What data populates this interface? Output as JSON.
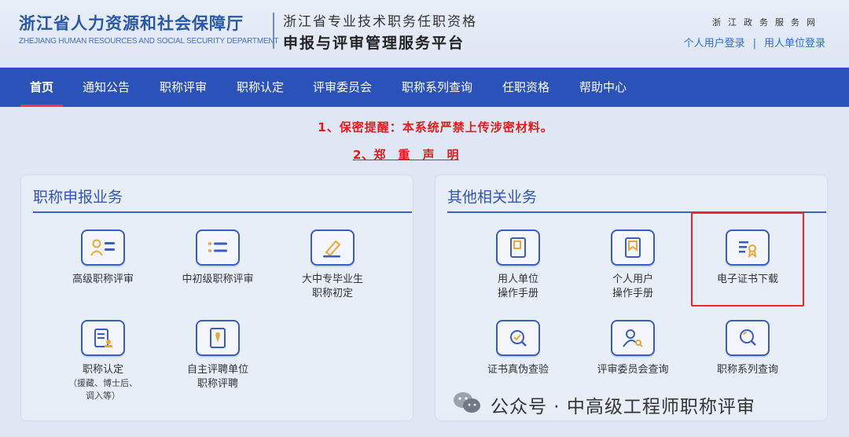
{
  "header": {
    "org_cn": "浙江省人力资源和社会保障厅",
    "org_en": "ZHEJIANG HUMAN RESOURCES AND SOCIAL SECURITY DEPARTMENT",
    "platform_line1": "浙江省专业技术职务任职资格",
    "platform_line2": "申报与评审管理服务平台",
    "gov_net": "浙江政务服务网",
    "login_personal": "个人用户登录",
    "login_sep": "|",
    "login_unit": "用人单位登录"
  },
  "nav": {
    "items": [
      "首页",
      "通知公告",
      "职称评审",
      "职称认定",
      "评审委员会",
      "职称系列查询",
      "任职资格",
      "帮助中心"
    ]
  },
  "notices": {
    "line1": "1、保密提醒：本系统严禁上传涉密材料。",
    "line2": "2、郑　重　声　明"
  },
  "left_panel": {
    "title": "职称申报业务",
    "tiles": [
      {
        "label": "高级职称评审",
        "icon": "person-card-icon"
      },
      {
        "label": "中初级职称评审",
        "icon": "list-icon"
      },
      {
        "label1": "大中专毕业生",
        "label2": "职称初定",
        "icon": "pen-edit-icon"
      },
      {
        "label": "职称认定",
        "sub1": "（援藏、博士后、",
        "sub2": "调入等）",
        "icon": "document-stamp-icon"
      },
      {
        "label1": "自主评聘单位",
        "label2": "职称评聘",
        "icon": "tie-badge-icon"
      }
    ]
  },
  "right_panel": {
    "title": "其他相关业务",
    "tiles": [
      {
        "label1": "用人单位",
        "label2": "操作手册",
        "icon": "book-icon"
      },
      {
        "label1": "个人用户",
        "label2": "操作手册",
        "icon": "bookmark-icon"
      },
      {
        "label": "电子证书下载",
        "icon": "certificate-icon"
      },
      {
        "label": "证书真伪查验",
        "icon": "verify-search-icon"
      },
      {
        "label": "评审委员会查询",
        "icon": "person-search-icon"
      },
      {
        "label": "职称系列查询",
        "icon": "search-icon"
      }
    ]
  },
  "watermark": {
    "text": "公众号 · 中高级工程师职称评审",
    "icon": "wechat-icon"
  },
  "colors": {
    "nav_bg": "#2b52b8",
    "accent": "#3455b3",
    "alert": "#e31b1b"
  }
}
